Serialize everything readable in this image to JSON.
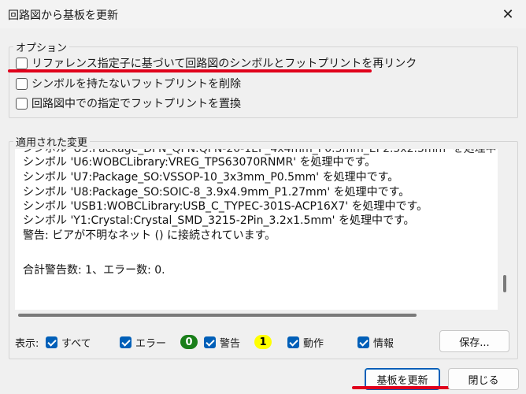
{
  "window": {
    "title": "回路図から基板を更新",
    "close_glyph": "✕"
  },
  "options": {
    "group_label": "オプション",
    "items": [
      {
        "label": "リファレンス指定子に基づいて回路図のシンボルとフットプリントを再リンク",
        "checked": false
      },
      {
        "label": "シンボルを持たないフットプリントを削除",
        "checked": false
      },
      {
        "label": "回路図中での指定でフットプリントを置換",
        "checked": false
      }
    ]
  },
  "changes": {
    "group_label": "適用された変更",
    "lines": [
      "シンボル 'U6:WOBCLibrary:VREG_TPS63070RNMR' を処理中です。",
      "シンボル 'U7:Package_SO:VSSOP-10_3x3mm_P0.5mm' を処理中です。",
      "シンボル 'U8:Package_SO:SOIC-8_3.9x4.9mm_P1.27mm' を処理中です。",
      "シンボル 'USB1:WOBCLibrary:USB_C_TYPEC-301S-ACP16X7' を処理中です。",
      "シンボル 'Y1:Crystal:Crystal_SMD_3215-2Pin_3.2x1.5mm' を処理中です。",
      "警告: ビアが不明なネット () に接続されています。",
      "合計警告数: 1、エラー数: 0."
    ]
  },
  "filters": {
    "show_label": "表示:",
    "all": "すべて",
    "errors": "エラー",
    "error_count": "0",
    "warnings": "警告",
    "warning_count": "1",
    "actions": "動作",
    "info": "情報",
    "save_button": "保存..."
  },
  "buttons": {
    "update": "基板を更新",
    "close": "閉じる"
  },
  "colors": {
    "accent": "#005fb8",
    "annotation": "#e0001b",
    "error_badge": "#1a7f1a",
    "warning_badge": "#ffff00"
  }
}
